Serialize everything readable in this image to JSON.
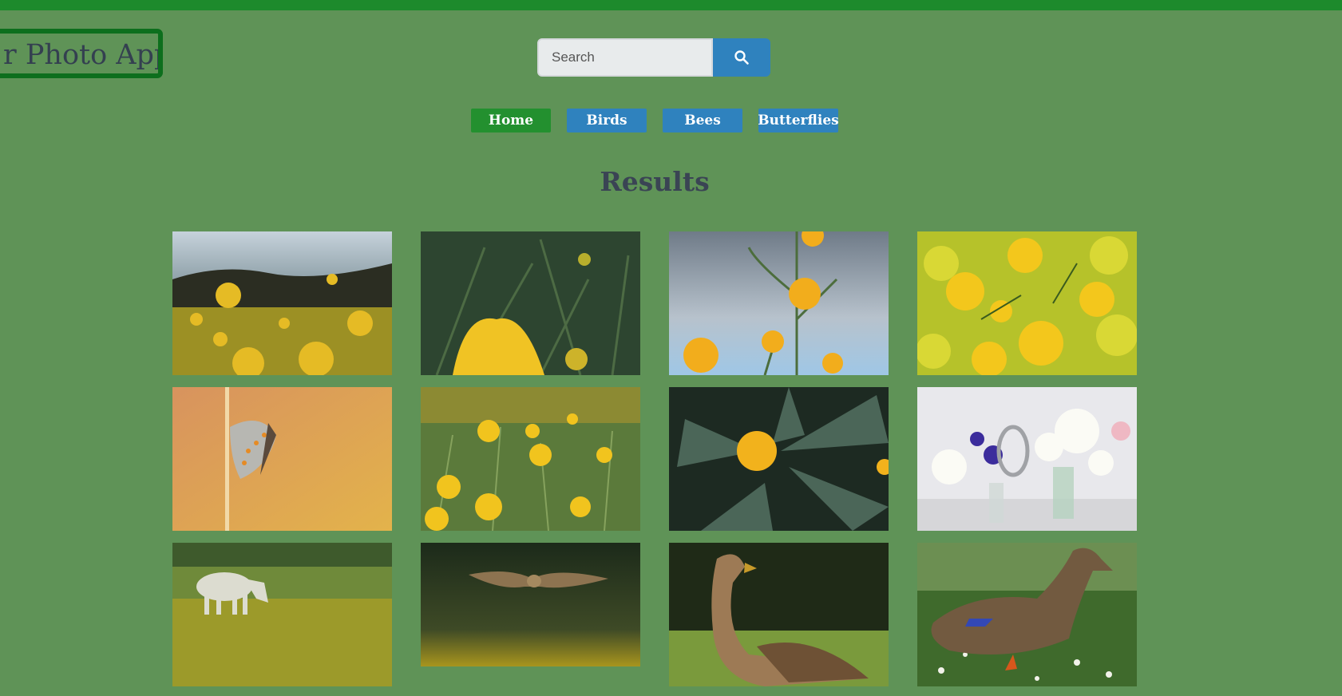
{
  "app": {
    "title": "r Photo App"
  },
  "search": {
    "placeholder": "Search",
    "button_icon": "search-icon"
  },
  "nav": {
    "items": [
      {
        "label": "Home",
        "active": true
      },
      {
        "label": "Birds",
        "active": false
      },
      {
        "label": "Bees",
        "active": false
      },
      {
        "label": "Butterflies",
        "active": false
      }
    ]
  },
  "results": {
    "heading": "Results"
  },
  "colors": {
    "page_background": "#5f9357",
    "top_strip": "#1d8a2c",
    "logo_border": "#0d6f1d",
    "nav_button": "#2f82be",
    "nav_active": "#23902f",
    "search_button": "#2f82be",
    "heading_text": "#3a4454"
  }
}
